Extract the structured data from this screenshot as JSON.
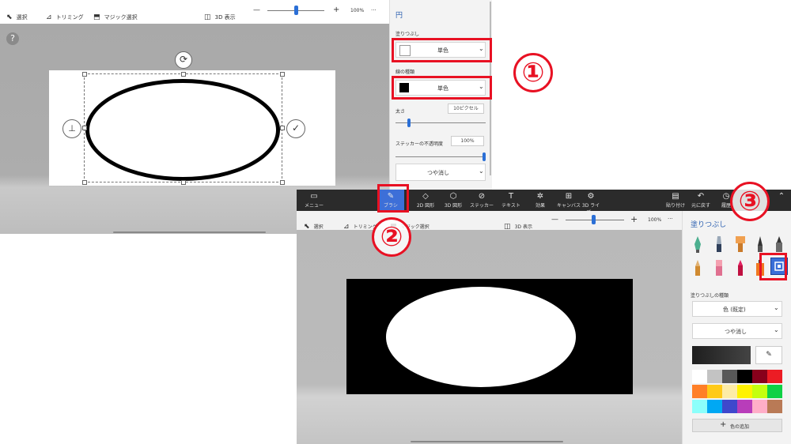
{
  "top": {
    "toolbar": {
      "select": "選択",
      "crop": "トリミング",
      "magic_select": "マジック選択",
      "view3d": "3D 表示",
      "zoom": "100%",
      "minus": "—",
      "plus": "+",
      "more": "···"
    },
    "help": "?",
    "panel": {
      "title": "円",
      "fill_label": "塗りつぶし",
      "fill_value": "単色",
      "line_label": "線の種類",
      "line_value": "単色",
      "thickness_label": "太さ",
      "thickness_value": "10ピクセル",
      "thickness_level": 0.15,
      "opacity_label": "ステッカーの不透明度",
      "opacity_value": "100%",
      "opacity_level": 1.0,
      "finish_value": "つや消し"
    }
  },
  "bottom": {
    "ribbon": [
      {
        "icon": "folder-icon",
        "glyph": "▭",
        "label": "メニュー"
      },
      {
        "icon": "brush-icon",
        "glyph": "✎",
        "label": "ブラシ"
      },
      {
        "icon": "shapes2d-icon",
        "glyph": "◇",
        "label": "2D 図形"
      },
      {
        "icon": "shapes3d-icon",
        "glyph": "⬡",
        "label": "3D 図形"
      },
      {
        "icon": "sticker-icon",
        "glyph": "⊘",
        "label": "ステッカー"
      },
      {
        "icon": "text-icon",
        "glyph": "T",
        "label": "テキスト"
      },
      {
        "icon": "effects-icon",
        "glyph": "✲",
        "label": "効果"
      },
      {
        "icon": "canvas-icon",
        "glyph": "⊞",
        "label": "キャンバス"
      },
      {
        "icon": "library3d-icon",
        "glyph": "⚙",
        "label": "3D ライブ..."
      }
    ],
    "ribbon_right": [
      {
        "icon": "paste-icon",
        "glyph": "▤",
        "label": "貼り付け"
      },
      {
        "icon": "undo-icon",
        "glyph": "↶",
        "label": "元に戻す"
      },
      {
        "icon": "history-icon",
        "glyph": "◷",
        "label": "履歴"
      }
    ],
    "toolbar": {
      "select": "選択",
      "crop": "トリミング",
      "magic_select": "マジック選択",
      "view3d": "3D 表示",
      "zoom": "100%",
      "minus": "—",
      "plus": "+",
      "more": "···"
    },
    "panel": {
      "title": "塗りつぶし",
      "fill_type_label": "塗りつぶしの種類",
      "fill_type_value": "色 (既定)",
      "finish_value": "つや消し",
      "add_color": "色の追加",
      "current_color": "#1e1e1e",
      "swatches": [
        "#ffffff",
        "#c3c3c3",
        "#585858",
        "#000000",
        "#88001b",
        "#ec1c24",
        "#ff7f27",
        "#ffca18",
        "#fdeca6",
        "#fff200",
        "#c4ff0e",
        "#0ed145",
        "#8cfffb",
        "#00a8f3",
        "#3f48cc",
        "#b83dba",
        "#ffaec8",
        "#b97a56"
      ]
    }
  },
  "markers": {
    "m1": "①",
    "m2": "②",
    "m3": "③"
  }
}
